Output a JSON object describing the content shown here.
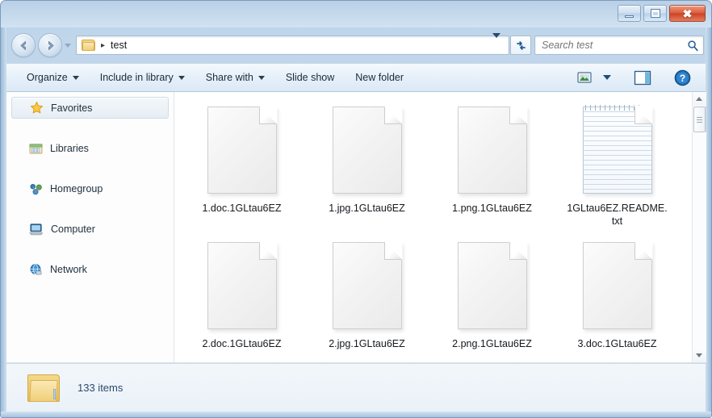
{
  "window": {
    "title": "",
    "controls": {
      "minimize": "Minimize",
      "maximize": "Maximize",
      "close": "Close"
    }
  },
  "navbar": {
    "back_tooltip": "Back",
    "forward_tooltip": "Forward",
    "history_tooltip": "Recent pages",
    "breadcrumb": {
      "separator": "▸",
      "path": "test"
    },
    "address_dropdown": "Previous locations",
    "refresh_tooltip": "Refresh",
    "search": {
      "placeholder": "Search test",
      "value": ""
    }
  },
  "commandbar": {
    "items": [
      {
        "label": "Organize",
        "has_menu": true
      },
      {
        "label": "Include in library",
        "has_menu": true
      },
      {
        "label": "Share with",
        "has_menu": true
      },
      {
        "label": "Slide show",
        "has_menu": false
      },
      {
        "label": "New folder",
        "has_menu": false
      }
    ],
    "right_items": [
      {
        "name": "change-view-button",
        "icon": "picture-view-icon",
        "has_menu": true
      },
      {
        "name": "preview-pane-button",
        "icon": "preview-pane-icon",
        "has_menu": false
      },
      {
        "name": "help-button",
        "icon": "help-icon",
        "has_menu": false
      }
    ]
  },
  "sidebar": {
    "items": [
      {
        "label": "Favorites",
        "icon": "star-icon",
        "selected": true
      },
      {
        "label": "Libraries",
        "icon": "library-icon",
        "selected": false
      },
      {
        "label": "Homegroup",
        "icon": "homegroup-icon",
        "selected": false
      },
      {
        "label": "Computer",
        "icon": "computer-icon",
        "selected": false
      },
      {
        "label": "Network",
        "icon": "network-globe-icon",
        "selected": false
      }
    ]
  },
  "content": {
    "files": [
      {
        "name": "1.doc.1GLtau6EZ",
        "icon": "blank-document-icon"
      },
      {
        "name": "1.jpg.1GLtau6EZ",
        "icon": "blank-document-icon"
      },
      {
        "name": "1.png.1GLtau6EZ",
        "icon": "blank-document-icon"
      },
      {
        "name": "1GLtau6EZ.README.txt",
        "icon": "text-document-icon"
      },
      {
        "name": "2.doc.1GLtau6EZ",
        "icon": "blank-document-icon"
      },
      {
        "name": "2.jpg.1GLtau6EZ",
        "icon": "blank-document-icon"
      },
      {
        "name": "2.png.1GLtau6EZ",
        "icon": "blank-document-icon"
      },
      {
        "name": "3.doc.1GLtau6EZ",
        "icon": "blank-document-icon"
      }
    ]
  },
  "scrollbar": {
    "up_label": "▲",
    "down_label": "▼"
  },
  "statusbar": {
    "folder_icon": "folder-icon",
    "item_count": "133 items"
  },
  "colors": {
    "accent": "#2c4a6b",
    "frame": "#bdd4e9",
    "close_button": "#c94425",
    "selection": "#e6eef5"
  }
}
